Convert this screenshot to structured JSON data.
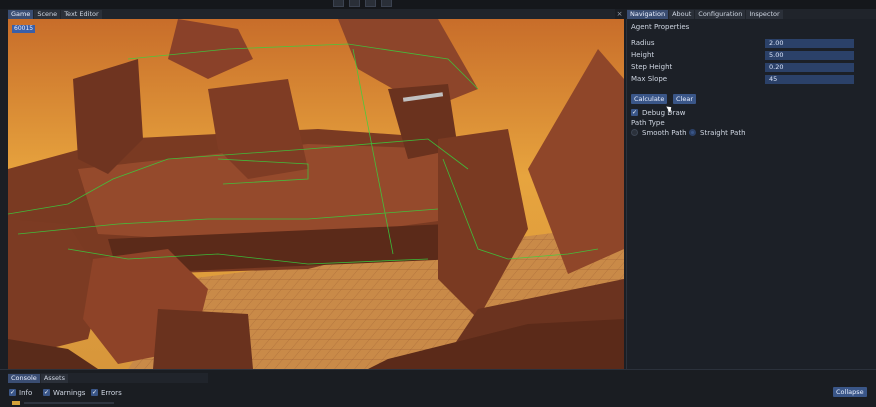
{
  "editor": {
    "left_tabs": [
      "Game",
      "Scene",
      "Text Editor"
    ],
    "close_glyph": "×",
    "fps_badge": "60015"
  },
  "inspector": {
    "tabs": [
      "Navigation",
      "About",
      "Configuration",
      "Inspector"
    ],
    "section_title": "Agent Properties",
    "properties": [
      {
        "label": "Radius",
        "value": "2.00"
      },
      {
        "label": "Height",
        "value": "5.00"
      },
      {
        "label": "Step Height",
        "value": "0.20"
      },
      {
        "label": "Max Slope",
        "value": "45"
      }
    ],
    "calculate_label": "Calculate",
    "clear_label": "Clear",
    "debug_draw_label": "Debug Draw",
    "debug_draw_checked": true,
    "path_type_label": "Path Type",
    "path_options": [
      "Smooth Path",
      "Straight Path"
    ],
    "path_selected": "Straight Path"
  },
  "console": {
    "tabs": [
      "Console",
      "Assets"
    ],
    "filters": [
      {
        "label": "Info",
        "checked": true
      },
      {
        "label": "Warnings",
        "checked": true
      },
      {
        "label": "Errors",
        "checked": true
      }
    ],
    "collapse_label": "Collapse"
  },
  "colors": {
    "accent": "#3a5688",
    "panel": "#1c2027",
    "sky_top": "#c86d2a",
    "sky_mid": "#e7a43e",
    "rock": "#8e4328",
    "navmesh_line": "#37d23e"
  }
}
